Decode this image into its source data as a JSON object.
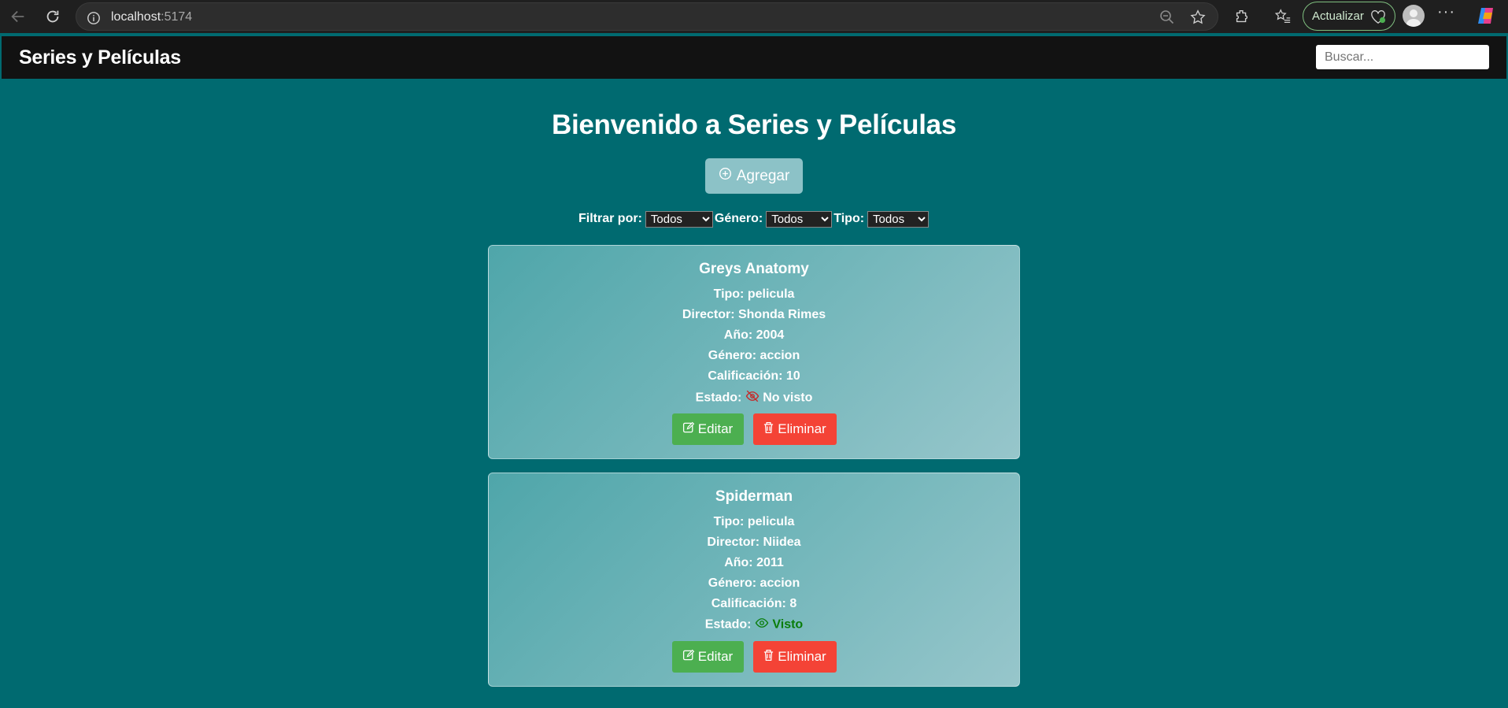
{
  "browser": {
    "url_host": "localhost",
    "url_port": ":5174",
    "update_label": "Actualizar"
  },
  "header": {
    "title": "Series y Películas",
    "search_placeholder": "Buscar..."
  },
  "main": {
    "title": "Bienvenido a Series y Películas",
    "add_label": "Agregar",
    "filters": {
      "filter_label": "Filtrar por:",
      "filter_value": "Todos",
      "genre_label": "Género:",
      "genre_value": "Todos",
      "type_label": "Tipo:",
      "type_value": "Todos"
    }
  },
  "cards": [
    {
      "title": "Greys Anatomy",
      "tipo": "Tipo: pelicula",
      "director": "Director: Shonda Rimes",
      "anio": "Año: 2004",
      "genero": "Género: accion",
      "calificacion": "Calificación: 10",
      "estado_label": "Estado:",
      "estado_value": "No visto",
      "estado_icon": "eye-off-icon",
      "edit_label": "Editar",
      "delete_label": "Eliminar"
    },
    {
      "title": "Spiderman",
      "tipo": "Tipo: pelicula",
      "director": "Director: Niidea",
      "anio": "Año: 2011",
      "genero": "Género: accion",
      "calificacion": "Calificación: 8",
      "estado_label": "Estado:",
      "estado_value": "Visto",
      "estado_icon": "eye-icon",
      "edit_label": "Editar",
      "delete_label": "Eliminar"
    }
  ],
  "colors": {
    "background": "#006a70",
    "header": "#121212",
    "edit": "#4caf50",
    "delete": "#f44336",
    "seen": "#0a7d0a",
    "not_seen_icon": "#c62828"
  }
}
